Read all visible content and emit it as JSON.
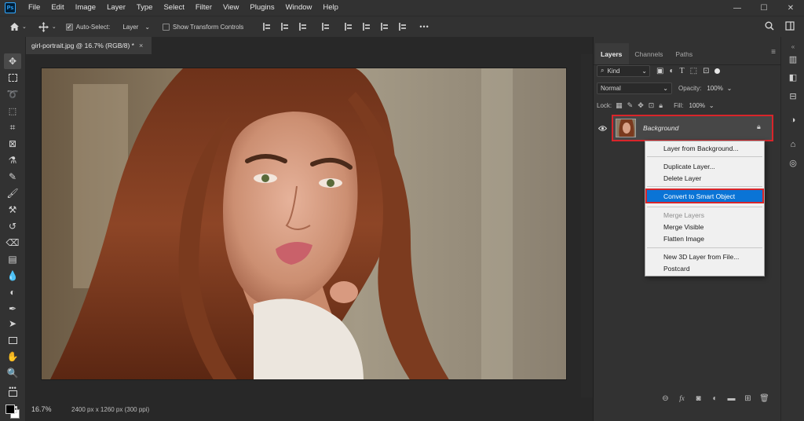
{
  "app": {
    "logo": "Ps"
  },
  "menu": [
    "File",
    "Edit",
    "Image",
    "Layer",
    "Type",
    "Select",
    "Filter",
    "View",
    "Plugins",
    "Window",
    "Help"
  ],
  "window_controls": {
    "minimize": "—",
    "maximize": "☐",
    "close": "✕"
  },
  "options_bar": {
    "auto_select_label": "Auto-Select:",
    "auto_select_checked": true,
    "auto_select_target": "Layer",
    "show_transform_label": "Show Transform Controls",
    "show_transform_checked": false,
    "more_label": "•••"
  },
  "document": {
    "tab_title": "girl-portrait.jpg @ 16.7% (RGB/8) *",
    "close_glyph": "×",
    "zoom": "16.7%",
    "info": "2400 px x 1260 px (300 ppi)"
  },
  "colors": {
    "foreground": "#000000",
    "background": "#ffffff",
    "highlight_outline": "#d9252a",
    "menu_selected": "#0a74d6"
  },
  "layers_panel": {
    "tabs": [
      "Layers",
      "Channels",
      "Paths"
    ],
    "active_tab": "Layers",
    "filter_kind": "Kind",
    "blend_mode": "Normal",
    "opacity_label": "Opacity:",
    "opacity_value": "100%",
    "lock_label": "Lock:",
    "fill_label": "Fill:",
    "fill_value": "100%",
    "layers": [
      {
        "name": "Background",
        "visible": true,
        "locked": true
      }
    ]
  },
  "context_menu": {
    "items": [
      {
        "label": "Layer from Background...",
        "enabled": true,
        "selected": false
      },
      {
        "label": "Duplicate Layer...",
        "enabled": true,
        "selected": false
      },
      {
        "label": "Delete Layer",
        "enabled": true,
        "selected": false
      },
      {
        "label": "Convert to Smart Object",
        "enabled": true,
        "selected": true
      },
      {
        "label": "Merge Layers",
        "enabled": false,
        "selected": false
      },
      {
        "label": "Merge Visible",
        "enabled": true,
        "selected": false
      },
      {
        "label": "Flatten Image",
        "enabled": true,
        "selected": false
      },
      {
        "label": "New 3D Layer from File...",
        "enabled": true,
        "selected": false
      },
      {
        "label": "Postcard",
        "enabled": true,
        "selected": false
      }
    ]
  }
}
